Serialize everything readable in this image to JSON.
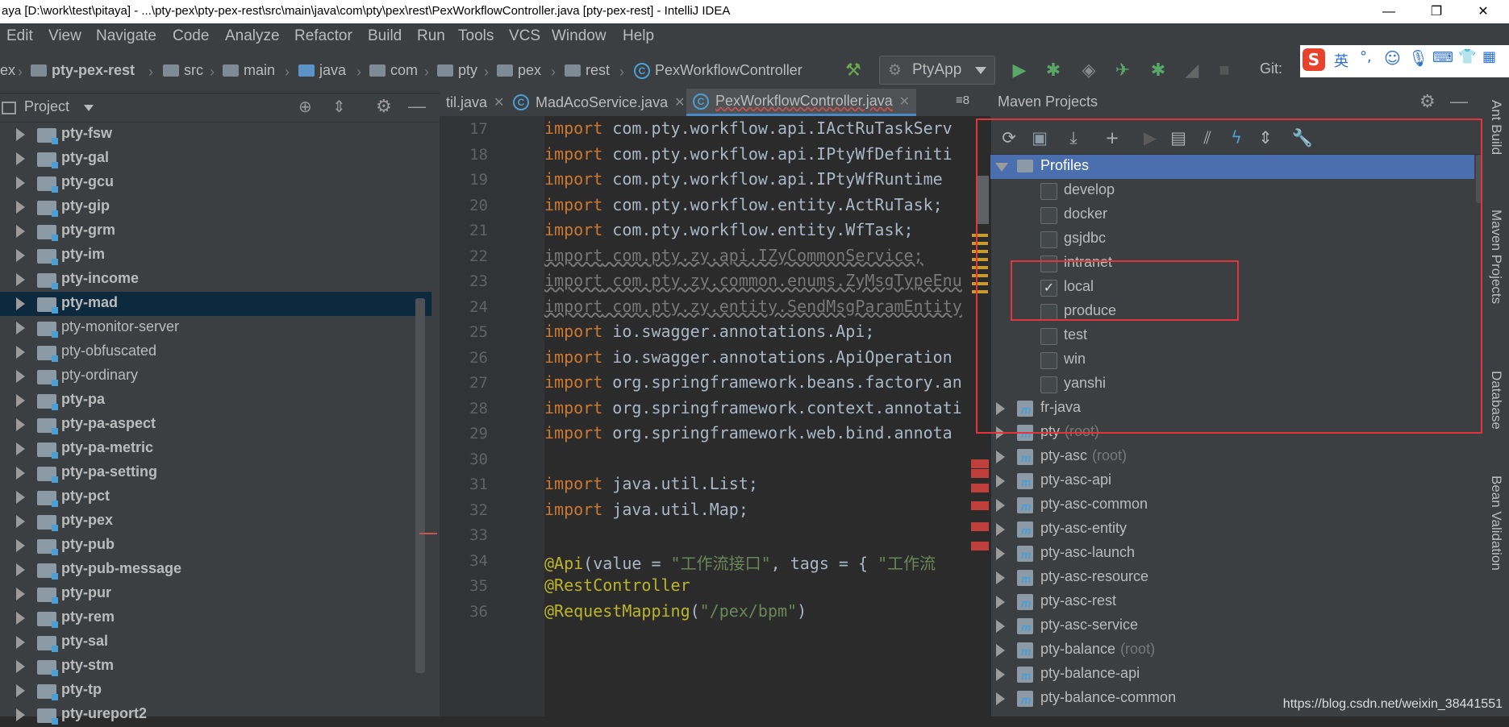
{
  "window": {
    "title": "aya [D:\\work\\test\\pitaya] - ...\\pty-pex\\pty-pex-rest\\src\\main\\java\\com\\pty\\pex\\rest\\PexWorkflowController.java [pty-pex-rest] - IntelliJ IDEA",
    "minimize": "—",
    "restore": "❐",
    "close": "✕"
  },
  "menu": [
    "Edit",
    "View",
    "Navigate",
    "Code",
    "Analyze",
    "Refactor",
    "Build",
    "Run",
    "Tools",
    "VCS",
    "Window",
    "Help"
  ],
  "breadcrumbs": [
    "ex",
    "pty-pex-rest",
    "src",
    "main",
    "java",
    "com",
    "pty",
    "pex",
    "rest",
    "PexWorkflowController"
  ],
  "toolbar": {
    "run_config": "PtyApp",
    "git_label": "Git:"
  },
  "project": {
    "title": "Project",
    "items": [
      {
        "label": "pty-fsw",
        "bold": true
      },
      {
        "label": "pty-gal",
        "bold": true
      },
      {
        "label": "pty-gcu",
        "bold": true
      },
      {
        "label": "pty-gip",
        "bold": true
      },
      {
        "label": "pty-grm",
        "bold": true
      },
      {
        "label": "pty-im",
        "bold": true
      },
      {
        "label": "pty-income",
        "bold": true
      },
      {
        "label": "pty-mad",
        "bold": true,
        "selected": true
      },
      {
        "label": "pty-monitor-server",
        "bold": false
      },
      {
        "label": "pty-obfuscated",
        "bold": false
      },
      {
        "label": "pty-ordinary",
        "bold": false
      },
      {
        "label": "pty-pa",
        "bold": true
      },
      {
        "label": "pty-pa-aspect",
        "bold": true
      },
      {
        "label": "pty-pa-metric",
        "bold": true
      },
      {
        "label": "pty-pa-setting",
        "bold": true
      },
      {
        "label": "pty-pct",
        "bold": true
      },
      {
        "label": "pty-pex",
        "bold": true
      },
      {
        "label": "pty-pub",
        "bold": true
      },
      {
        "label": "pty-pub-message",
        "bold": true
      },
      {
        "label": "pty-pur",
        "bold": true
      },
      {
        "label": "pty-rem",
        "bold": true
      },
      {
        "label": "pty-sal",
        "bold": true
      },
      {
        "label": "pty-stm",
        "bold": true
      },
      {
        "label": "pty-tp",
        "bold": true
      },
      {
        "label": "pty-ureport2",
        "bold": true
      }
    ]
  },
  "editor": {
    "tabs": [
      "til.java",
      "MadAcoService.java",
      "PexWorkflowController.java"
    ],
    "tab_overflow": "≡8",
    "lines": [
      {
        "n": "17",
        "kw": "import",
        "rest": " com.pty.workflow.api.IActRuTaskServ",
        "style": "normal"
      },
      {
        "n": "18",
        "kw": "import",
        "rest": " com.pty.workflow.api.IPtyWfDefiniti",
        "style": "normal"
      },
      {
        "n": "19",
        "kw": "import",
        "rest": " com.pty.workflow.api.IPtyWfRuntime",
        "style": "normal"
      },
      {
        "n": "20",
        "kw": "import",
        "rest": " com.pty.workflow.entity.ActRuTask;",
        "style": "normal"
      },
      {
        "n": "21",
        "kw": "import",
        "rest": " com.pty.workflow.entity.WfTask;",
        "style": "normal"
      },
      {
        "n": "22",
        "kw": "import",
        "rest": " com.pty.zy.api.IZyCommonService;",
        "style": "unused"
      },
      {
        "n": "23",
        "kw": "import",
        "rest": " com.pty.zy.common.enums.ZyMsgTypeEnu",
        "style": "unused"
      },
      {
        "n": "24",
        "kw": "import",
        "rest": " com.pty.zy.entity.SendMsgParamEntity",
        "style": "unused"
      },
      {
        "n": "25",
        "kw": "import",
        "rest": " io.swagger.annotations.Api;",
        "style": "normal"
      },
      {
        "n": "26",
        "kw": "import",
        "rest": " io.swagger.annotations.ApiOperation",
        "style": "normal"
      },
      {
        "n": "27",
        "kw": "import",
        "rest": " org.springframework.beans.factory.an",
        "style": "normal"
      },
      {
        "n": "28",
        "kw": "import",
        "rest": " org.springframework.context.annotati",
        "style": "normal"
      },
      {
        "n": "29",
        "kw": "import",
        "rest": " org.springframework.web.bind.annota",
        "style": "normal"
      },
      {
        "n": "30",
        "kw": "",
        "rest": "",
        "style": "normal"
      },
      {
        "n": "31",
        "kw": "import",
        "rest": " java.util.List;",
        "style": "normal"
      },
      {
        "n": "32",
        "kw": "import",
        "rest": " java.util.Map;",
        "style": "normal"
      },
      {
        "n": "33",
        "kw": "",
        "rest": "",
        "style": "normal"
      },
      {
        "n": "34",
        "kw": "",
        "rest": "",
        "style": "api"
      },
      {
        "n": "35",
        "kw": "",
        "rest": "@RestController",
        "style": "annot"
      },
      {
        "n": "36",
        "kw": "",
        "rest": "",
        "style": "mapping"
      }
    ],
    "line34": {
      "annot": "@Api",
      "p1": "(value = ",
      "s1": "\"工作流接口\"",
      "p2": ", tags = { ",
      "s2": "\"工作流"
    },
    "line36": {
      "annot": "@RequestMapping",
      "p1": "(",
      "s1": "\"/pex/bpm\"",
      "p2": ")"
    }
  },
  "maven": {
    "title": "Maven Projects",
    "profiles_label": "Profiles",
    "profiles": [
      {
        "name": "develop",
        "checked": false
      },
      {
        "name": "docker",
        "checked": false
      },
      {
        "name": "gsjdbc",
        "checked": false
      },
      {
        "name": "intranet",
        "checked": false
      },
      {
        "name": "local",
        "checked": true
      },
      {
        "name": "produce",
        "checked": false
      },
      {
        "name": "test",
        "checked": false
      },
      {
        "name": "win",
        "checked": false
      },
      {
        "name": "yanshi",
        "checked": false
      }
    ],
    "projects": [
      {
        "name": "fr-java",
        "root": ""
      },
      {
        "name": "pty",
        "root": "(root)"
      },
      {
        "name": "pty-asc",
        "root": "(root)"
      },
      {
        "name": "pty-asc-api",
        "root": ""
      },
      {
        "name": "pty-asc-common",
        "root": ""
      },
      {
        "name": "pty-asc-entity",
        "root": ""
      },
      {
        "name": "pty-asc-launch",
        "root": ""
      },
      {
        "name": "pty-asc-resource",
        "root": ""
      },
      {
        "name": "pty-asc-rest",
        "root": ""
      },
      {
        "name": "pty-asc-service",
        "root": ""
      },
      {
        "name": "pty-balance",
        "root": "(root)"
      },
      {
        "name": "pty-balance-api",
        "root": ""
      },
      {
        "name": "pty-balance-common",
        "root": ""
      }
    ]
  },
  "right_sidebar": [
    "Ant Build",
    "Maven Projects",
    "Database",
    "Bean Validation"
  ],
  "ime": {
    "logo": "S",
    "lang": "英"
  },
  "watermark": "https://blog.csdn.net/weixin_38441551",
  "colors": {
    "accent": "#4a88c7",
    "highlight_box": "#e0353b",
    "selected_row": "#0d293e"
  }
}
